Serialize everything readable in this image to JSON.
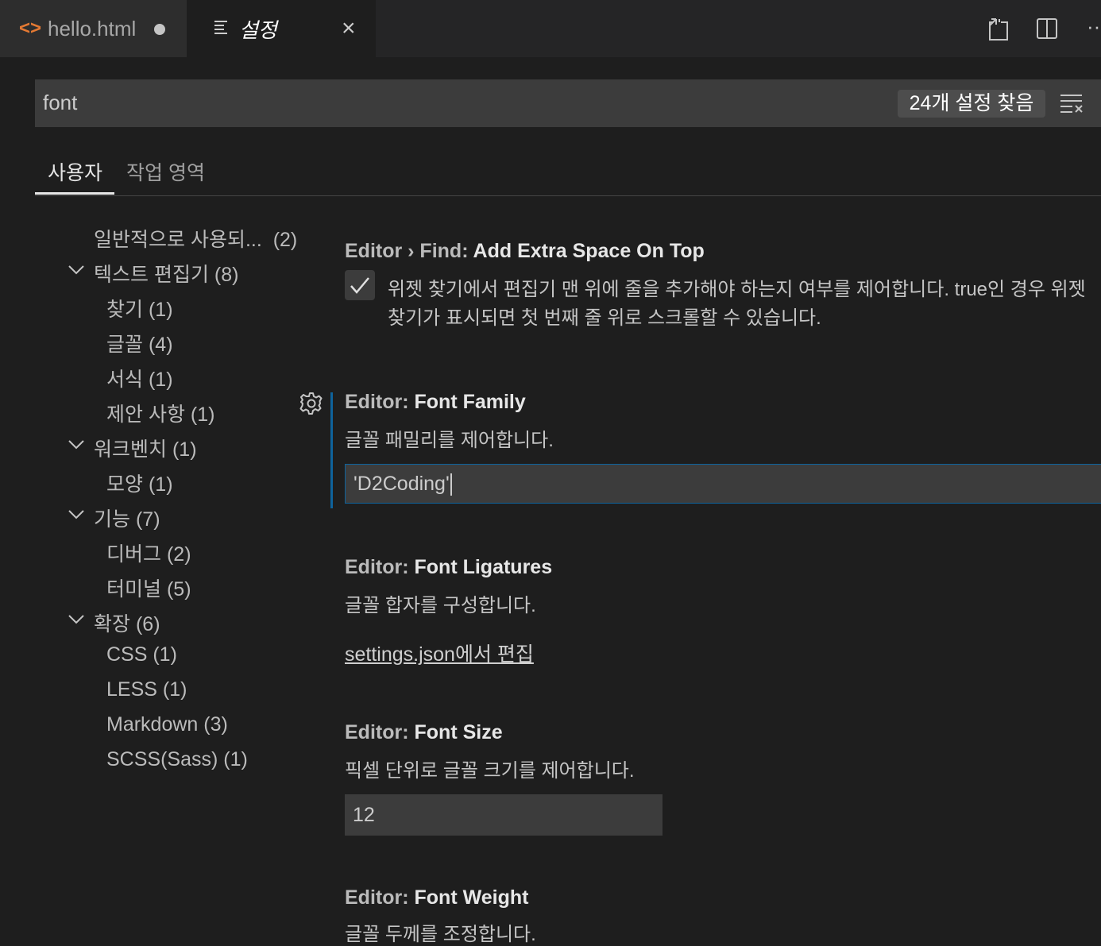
{
  "tabs": [
    {
      "label": "hello.html",
      "icon": "code-icon",
      "dirty": true
    },
    {
      "label": "설정",
      "icon": "settings-file-icon",
      "active": true
    }
  ],
  "search": {
    "value": "font",
    "count": "24개 설정 찾음"
  },
  "scope_tabs": {
    "user": "사용자",
    "workspace": "작업 영역"
  },
  "toc": [
    {
      "label": "일반적으로 사용되...",
      "count": "(2)"
    },
    {
      "label": "텍스트 편집기",
      "count": "(8)",
      "expanded": true
    },
    {
      "label": "찾기",
      "count": "(1)"
    },
    {
      "label": "글꼴",
      "count": "(4)"
    },
    {
      "label": "서식",
      "count": "(1)"
    },
    {
      "label": "제안 사항",
      "count": "(1)"
    },
    {
      "label": "워크벤치",
      "count": "(1)",
      "expanded": true
    },
    {
      "label": "모양",
      "count": "(1)"
    },
    {
      "label": "기능",
      "count": "(7)",
      "expanded": true
    },
    {
      "label": "디버그",
      "count": "(2)"
    },
    {
      "label": "터미널",
      "count": "(5)"
    },
    {
      "label": "확장",
      "count": "(6)",
      "expanded": true
    },
    {
      "label": "CSS",
      "count": "(1)"
    },
    {
      "label": "LESS",
      "count": "(1)"
    },
    {
      "label": "Markdown",
      "count": "(3)"
    },
    {
      "label": "SCSS(Sass)",
      "count": "(1)"
    }
  ],
  "settings": {
    "extra_space": {
      "category": "Editor › Find: ",
      "name": "Add Extra Space On Top",
      "desc_line1": "위젯 찾기에서 편집기 맨 위에 줄을 추가해야 하는지 여부를 제어합니다. true인 경우 위젯",
      "desc_line2": "찾기가 표시되면 첫 번째 줄 위로 스크롤할 수 있습니다.",
      "checked": true
    },
    "font_family": {
      "category": "Editor: ",
      "name": "Font Family",
      "desc": "글꼴 패밀리를 제어합니다.",
      "value": "'D2Coding'"
    },
    "font_ligatures": {
      "category": "Editor: ",
      "name": "Font Ligatures",
      "desc": "글꼴 합자를 구성합니다.",
      "link": "settings.json에서 편집"
    },
    "font_size": {
      "category": "Editor: ",
      "name": "Font Size",
      "desc": "픽셀 단위로 글꼴 크기를 제어합니다.",
      "value": "12"
    },
    "font_weight": {
      "category": "Editor: ",
      "name": "Font Weight",
      "desc": "글꼴 두께를 조정합니다."
    }
  }
}
